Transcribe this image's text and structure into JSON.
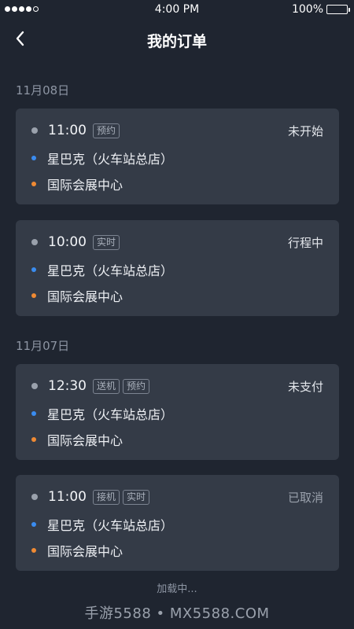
{
  "status_bar": {
    "time": "4:00 PM",
    "battery": "100%",
    "battery_level": 1.0
  },
  "header": {
    "title": "我的订单"
  },
  "groups": [
    {
      "date": "11月08日",
      "orders": [
        {
          "time": "11:00",
          "tags": [
            "预约"
          ],
          "status": "未开始",
          "from": "星巴克（火车站总店）",
          "to": "国际会展中心"
        },
        {
          "time": "10:00",
          "tags": [
            "实时"
          ],
          "status": "行程中",
          "from": "星巴克（火车站总店）",
          "to": "国际会展中心"
        }
      ]
    },
    {
      "date": "11月07日",
      "orders": [
        {
          "time": "12:30",
          "tags": [
            "送机",
            "预约"
          ],
          "status": "未支付",
          "from": "星巴克（火车站总店）",
          "to": "国际会展中心"
        },
        {
          "time": "11:00",
          "tags": [
            "接机",
            "实时"
          ],
          "status": "已取消",
          "from": "星巴克（火车站总店）",
          "to": "国际会展中心"
        }
      ]
    }
  ],
  "footer": {
    "loading": "加载中...",
    "watermark": "手游5588 • MX5588.COM"
  },
  "colors": {
    "background": "#1f2530",
    "card": "#343b47",
    "origin_dot": "#3a8cf0",
    "destination_dot": "#f08a33"
  }
}
